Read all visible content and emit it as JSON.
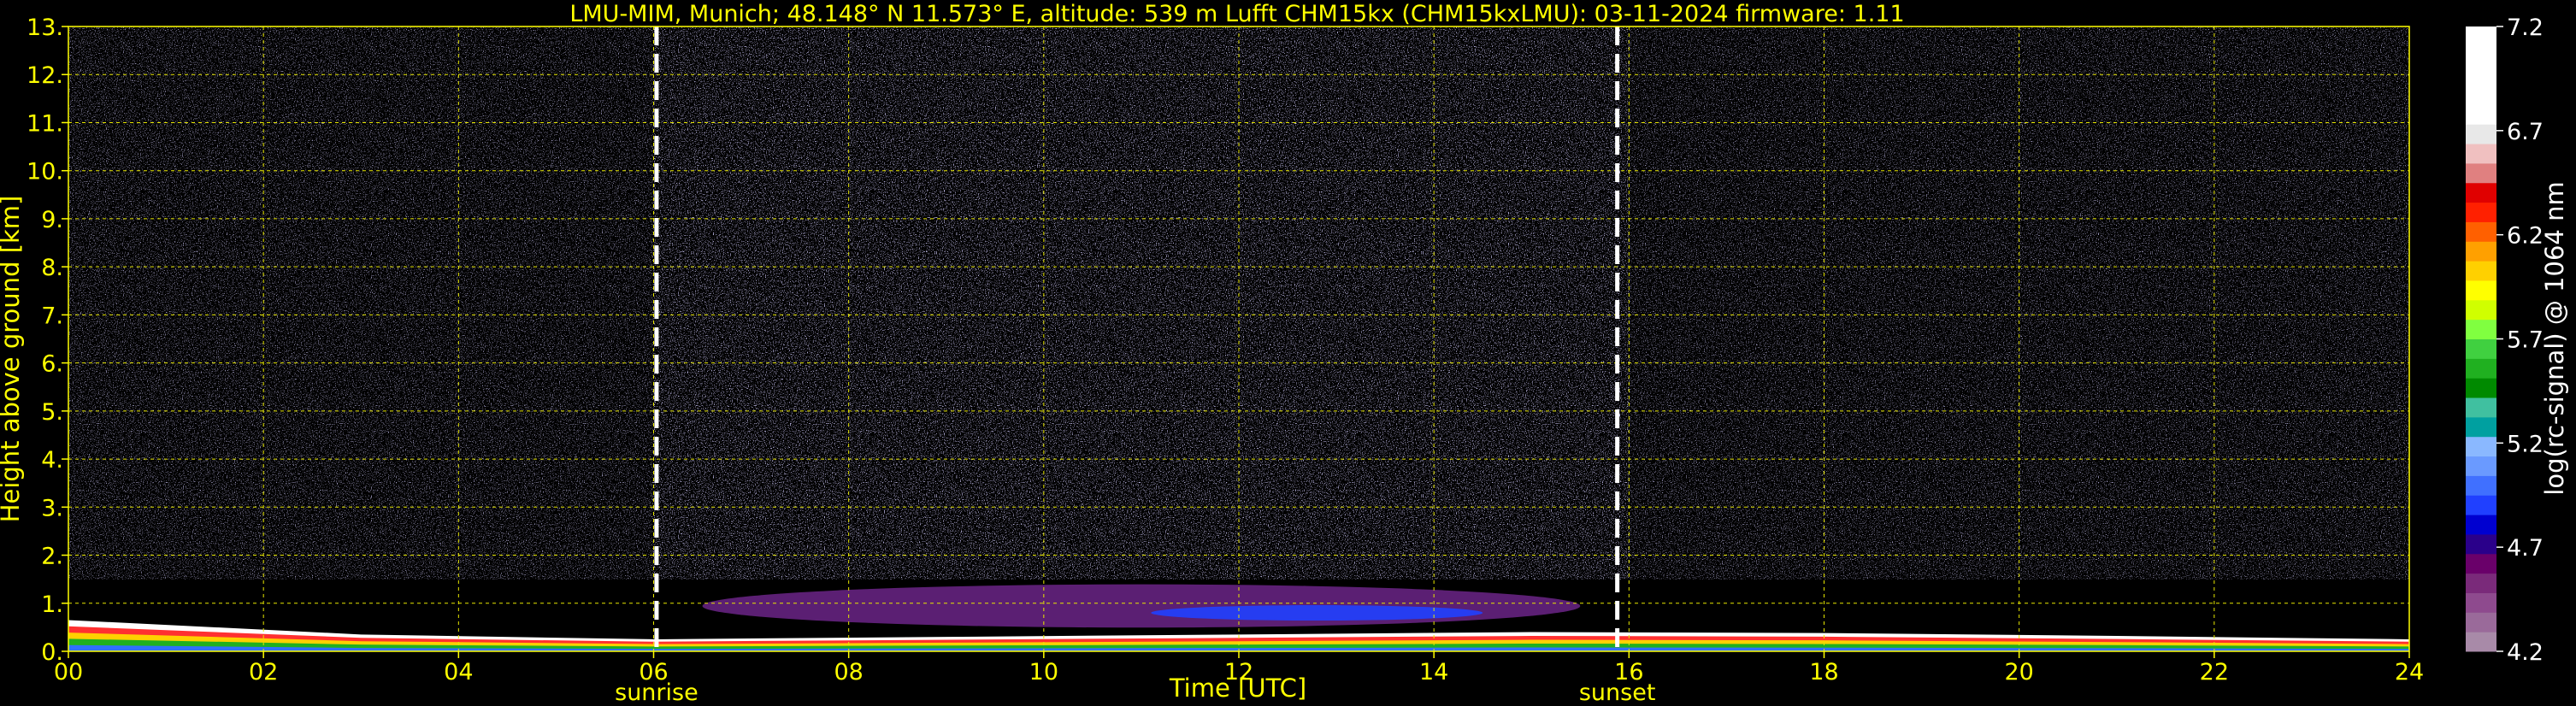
{
  "chart_data": {
    "type": "heatmap",
    "title": "LMU-MIM, Munich; 48.148° N 11.573° E, altitude: 539 m    Lufft CHM15kx (CHM15kxLMU): 03-11-2024    firmware: 1.11",
    "xlabel": "Time [UTC]",
    "ylabel": "Height above ground [km]",
    "xlim": [
      0,
      24
    ],
    "ylim": [
      0,
      13
    ],
    "x_ticks": [
      "00",
      "02",
      "04",
      "06",
      "08",
      "10",
      "12",
      "14",
      "16",
      "18",
      "20",
      "22",
      "24"
    ],
    "y_ticks": [
      "0.",
      "1.",
      "2.",
      "3.",
      "4.",
      "5.",
      "6.",
      "7.",
      "8.",
      "9.",
      "10.",
      "11.",
      "12.",
      "13."
    ],
    "grid": true,
    "markers": [
      {
        "label": "sunrise",
        "x": 6.03
      },
      {
        "label": "sunset",
        "x": 15.88
      }
    ],
    "colorbar": {
      "label": "log(rc-signal) @ 1064 nm",
      "range": [
        4.2,
        7.2
      ],
      "ticks": [
        "4.2",
        "4.7",
        "5.2",
        "5.7",
        "6.2",
        "6.7",
        "7.2"
      ],
      "colors": [
        "#a88aa8",
        "#9a6a9a",
        "#8e4a8e",
        "#7a2a7a",
        "#6a006a",
        "#2a008a",
        "#0000d0",
        "#2040ff",
        "#4070ff",
        "#6a9aff",
        "#8ab8ff",
        "#00a0a0",
        "#40c0a0",
        "#008a00",
        "#20b020",
        "#40d040",
        "#80ff40",
        "#d0ff00",
        "#ffff00",
        "#ffd000",
        "#ffa000",
        "#ff6000",
        "#ff2000",
        "#e00000",
        "#e08080",
        "#f0c0c0",
        "#e8e8e8",
        "#ffffff",
        "#ffffff",
        "#ffffff",
        "#ffffff",
        "#ffffff"
      ]
    },
    "features": [
      {
        "name": "boundary layer aerosol",
        "x": [
          0,
          24
        ],
        "top_km": [
          0.65,
          0.35,
          0.25,
          0.3,
          0.35,
          0.4,
          0.38,
          0.32,
          0.25
        ],
        "dominant_value": 6.2
      },
      {
        "name": "elevated aerosol layer",
        "x": [
          6.5,
          15.5
        ],
        "height_km": [
          0.6,
          1.5
        ],
        "dominant_value": 4.7
      },
      {
        "name": "noise field",
        "x": [
          0,
          24
        ],
        "height_km": [
          1.5,
          13
        ],
        "dominant_value": 4.9
      }
    ]
  }
}
